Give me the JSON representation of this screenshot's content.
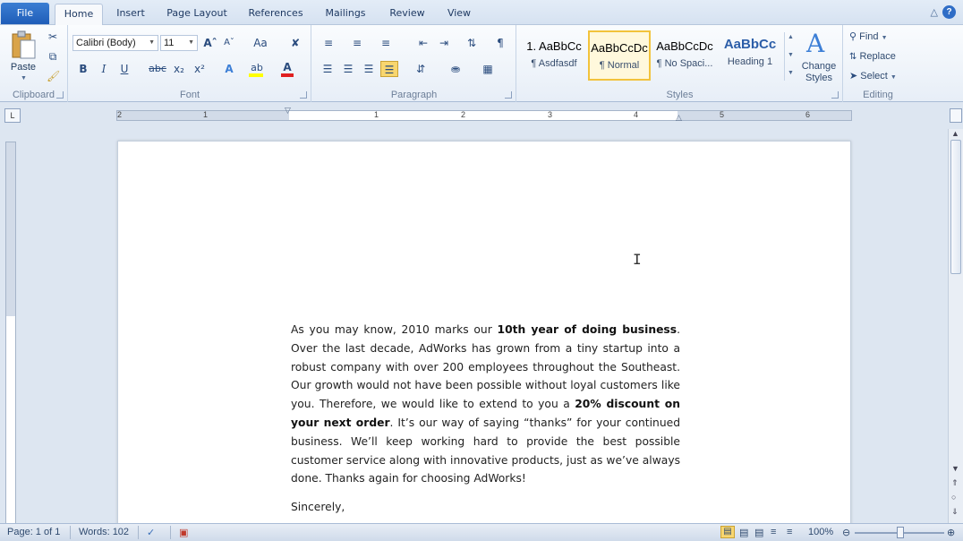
{
  "tabs": [
    "File",
    "Home",
    "Insert",
    "Page Layout",
    "References",
    "Mailings",
    "Review",
    "View"
  ],
  "clipboard": {
    "paste": "Paste",
    "label": "Clipboard"
  },
  "font": {
    "name": "Calibri (Body)",
    "size": "11",
    "label": "Font",
    "case_btn": "Aa"
  },
  "paragraph": {
    "label": "Paragraph"
  },
  "styles": {
    "label": "Styles",
    "items": [
      {
        "sample": "1. AaBbCc",
        "name": "¶ Asdfasdf"
      },
      {
        "sample": "AaBbCcDc",
        "name": "¶ Normal"
      },
      {
        "sample": "AaBbCcDc",
        "name": "¶ No Spaci..."
      },
      {
        "sample": "AaBbCc",
        "name": "Heading 1"
      }
    ],
    "change": "Change Styles"
  },
  "editing": {
    "label": "Editing",
    "find": "Find",
    "replace": "Replace",
    "select": "Select"
  },
  "ruler_numbers": [
    "2",
    "1",
    "1",
    "2",
    "3",
    "4",
    "5",
    "6"
  ],
  "document": {
    "p1": "As you may know, 2010 marks our ",
    "b1": "10th year of doing business",
    "p2": ". Over the last decade, AdWorks has grown from a tiny startup into a robust company with over 200 employees throughout the Southeast. Our growth would not have been possible without loyal customers like you. Therefore, we would like to extend to you a ",
    "b2": "20% discount on your next order",
    "p3": ". It’s our way of saying “thanks” for your continued business. We’ll keep working hard to provide the best possible customer service along with innovative products, just as we’ve always done. Thanks again for choosing AdWorks!",
    "closing": "Sincerely,"
  },
  "status": {
    "page": "Page: 1 of 1",
    "words": "Words: 102",
    "zoom": "100%"
  },
  "colors": {
    "file_tab": "#2a6cc9",
    "highlight": "#ffff00",
    "font_color": "#e02020",
    "selected_style": "#f2c33c"
  }
}
